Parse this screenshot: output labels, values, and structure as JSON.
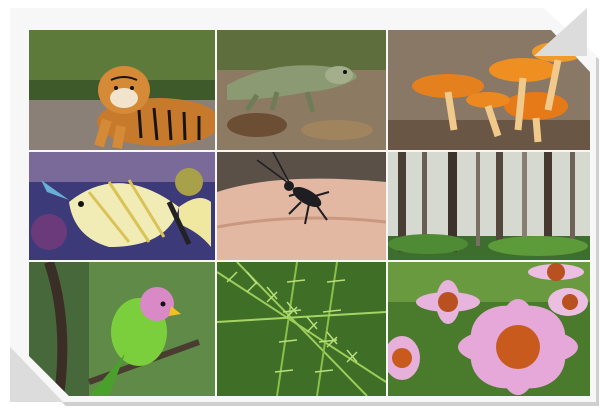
{
  "collage": {
    "tiles": [
      {
        "subject": "tiger"
      },
      {
        "subject": "lizard"
      },
      {
        "subject": "orange-mushrooms"
      },
      {
        "subject": "butterflyfish"
      },
      {
        "subject": "beetle-on-hand"
      },
      {
        "subject": "misty-forest"
      },
      {
        "subject": "parakeet"
      },
      {
        "subject": "fern-leaves"
      },
      {
        "subject": "coneflowers"
      }
    ]
  }
}
